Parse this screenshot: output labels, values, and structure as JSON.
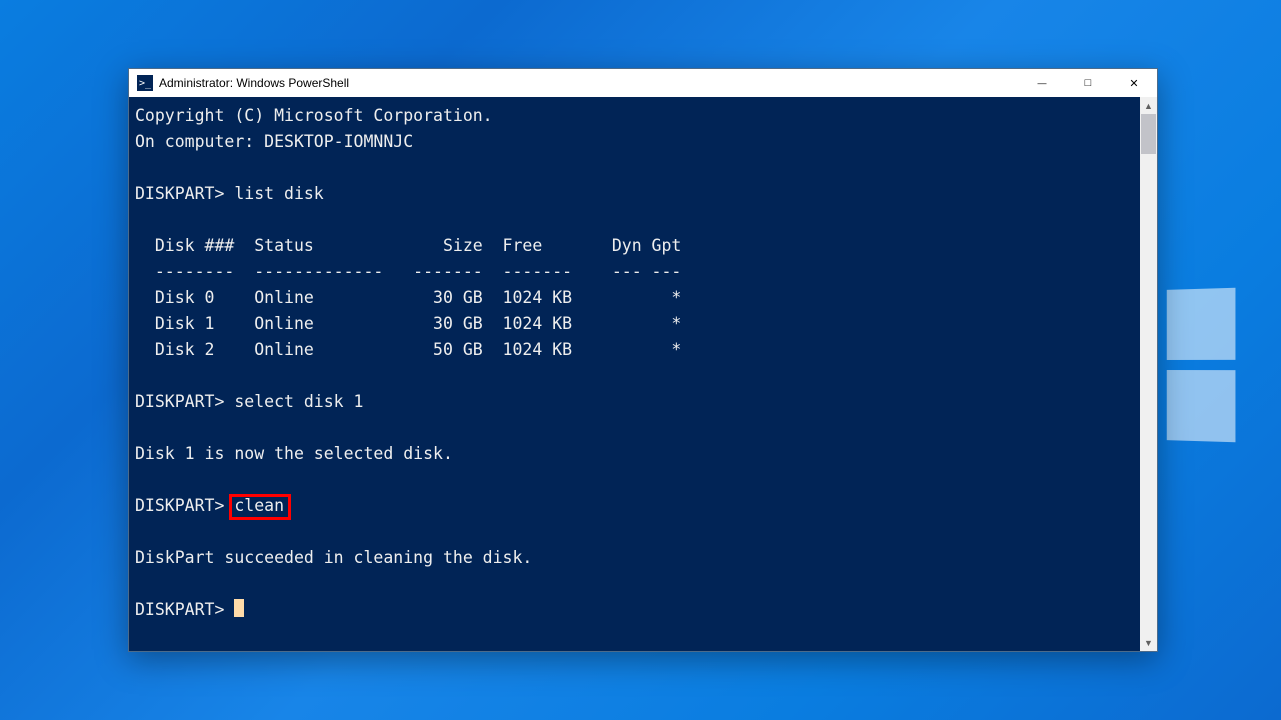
{
  "window": {
    "title": "Administrator: Windows PowerShell",
    "icon_glyph": ">_"
  },
  "terminal": {
    "copyright": "Copyright (C) Microsoft Corporation.",
    "on_computer_label": "On computer: ",
    "computer_name": "DESKTOP-IOMNNJC",
    "prompt": "DISKPART>",
    "cmd_list_disk": "list disk",
    "table": {
      "headers": {
        "disk": "Disk ###",
        "status": "Status",
        "size": "Size",
        "free": "Free",
        "dyn": "Dyn",
        "gpt": "Gpt"
      },
      "dividers": {
        "disk": "--------",
        "status": "-------------",
        "size": "-------",
        "free": "-------",
        "dyn": "---",
        "gpt": "---"
      },
      "rows": [
        {
          "disk": "Disk 0",
          "status": "Online",
          "size": "30 GB",
          "free": "1024 KB",
          "dyn": "",
          "gpt": "*"
        },
        {
          "disk": "Disk 1",
          "status": "Online",
          "size": "30 GB",
          "free": "1024 KB",
          "dyn": "",
          "gpt": "*"
        },
        {
          "disk": "Disk 2",
          "status": "Online",
          "size": "50 GB",
          "free": "1024 KB",
          "dyn": "",
          "gpt": "*"
        }
      ]
    },
    "cmd_select": "select disk 1",
    "msg_selected": "Disk 1 is now the selected disk.",
    "cmd_clean": "clean",
    "msg_clean_success": "DiskPart succeeded in cleaning the disk."
  },
  "highlight": {
    "target": "clean"
  }
}
